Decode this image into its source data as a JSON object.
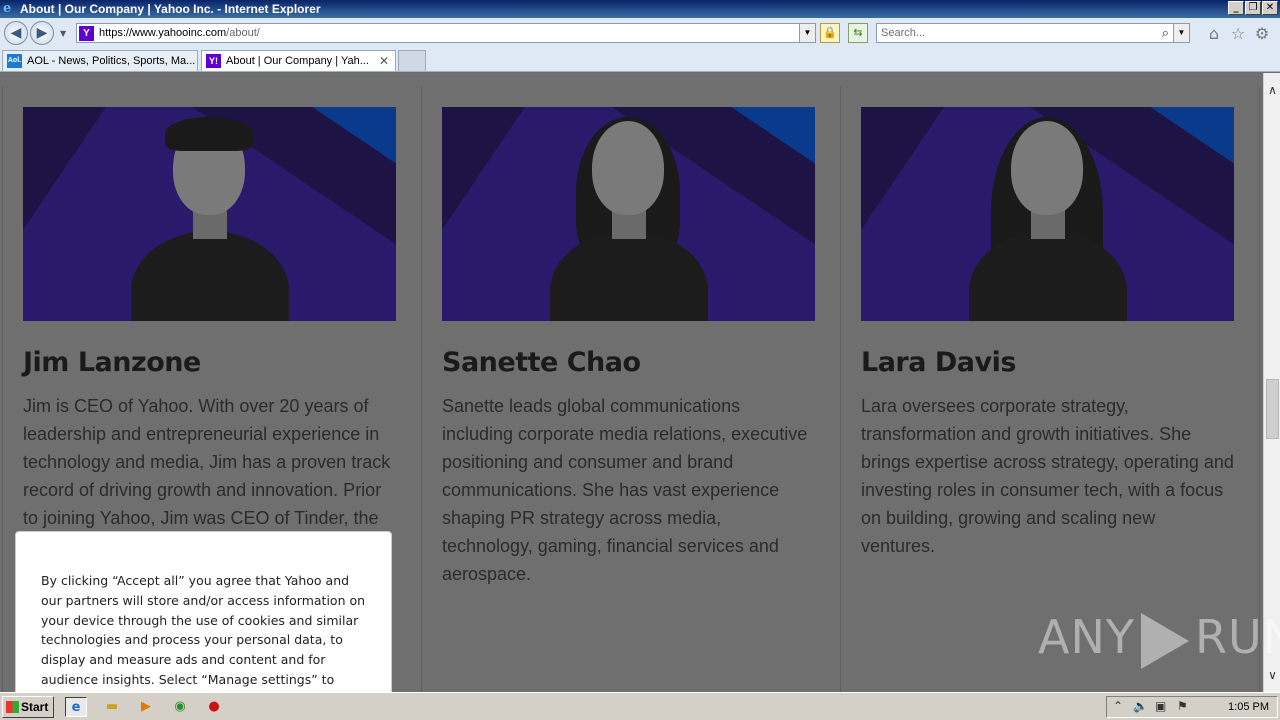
{
  "window": {
    "title": "About | Our Company | Yahoo Inc. - Internet Explorer",
    "controls": [
      "_",
      "❐",
      "✕"
    ]
  },
  "navbar": {
    "url_prefix": "https://www.yahooinc.com",
    "url_path": "/about/",
    "search_placeholder": "Search..."
  },
  "tabs": [
    {
      "label": "AOL - News, Politics, Sports, Ma...",
      "icon_text": "Aol."
    },
    {
      "label": "About | Our Company | Yah...",
      "icon_text": "Y!",
      "close": "✕"
    }
  ],
  "people": [
    {
      "name": "Jim Lanzone",
      "bio": "Jim is CEO of Yahoo. With over 20 years of leadership and entrepreneurial experience in technology and media, Jim has a proven track record of driving growth and innovation. Prior to joining Yahoo, Jim was CEO of Tinder, the"
    },
    {
      "name": "Sanette Chao",
      "bio": "Sanette leads global communications including corporate media relations, executive positioning and consumer and brand communications. She has vast experience shaping PR strategy across media, technology, gaming, financial services and aerospace."
    },
    {
      "name": "Lara Davis",
      "bio": "Lara oversees corporate strategy, transformation and growth initiatives.  She brings expertise across strategy, operating and investing roles in consumer tech, with a focus on building, growing and scaling new ventures."
    }
  ],
  "cookie": {
    "text": "By clicking “Accept all” you agree that Yahoo and our partners will store and/or access information on your device through the use of cookies and similar technologies and process your personal data, to display and measure ads and content and for audience insights. Select “Manage settings” to manage"
  },
  "watermark": {
    "left": "ANY",
    "right": "RUN"
  },
  "taskbar": {
    "start_label": "Start",
    "clock": "1:05 PM"
  }
}
